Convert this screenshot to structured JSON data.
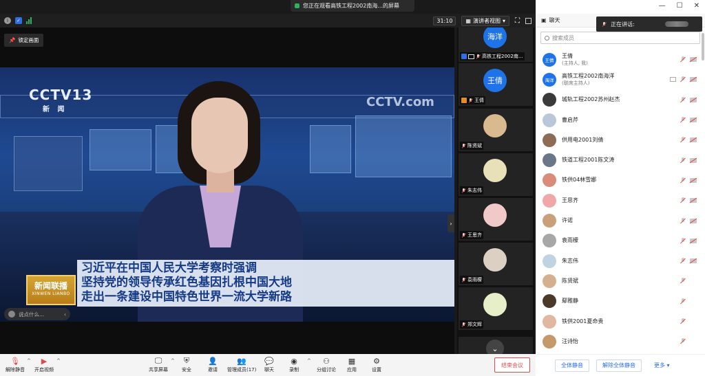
{
  "banner": {
    "text": "您正在观看高铁工程2002南海...的屏幕"
  },
  "topbar": {
    "timer": "31:10",
    "view_label": "演讲者视图"
  },
  "video": {
    "lock_label": "锁定画面",
    "channel_logo": "CCTV13",
    "channel_sub": "新 闻",
    "watermark": "CCTV.com",
    "headline": [
      "习近平在中国人民大学考察时强调",
      "坚持党的领导传承红色基因扎根中国大地",
      "走出一条建设中国特色世界一流大学新路"
    ],
    "program_logo": "新闻联播",
    "program_logo_en": "XINWEN LIANBO",
    "chat_placeholder": "说点什么..."
  },
  "gallery": [
    {
      "avatar_text": "海洋",
      "avatar_color": "#1f73e8",
      "name": "高铁工程2002南...",
      "cohost": true,
      "screen": true
    },
    {
      "avatar_text": "王倩",
      "avatar_color": "#1f73e8",
      "name": "王倩",
      "host": true
    },
    {
      "avatar_text": "",
      "avatar_color": "#d9b98e",
      "name": "陈贤斌"
    },
    {
      "avatar_text": "",
      "avatar_color": "#e7e0b8",
      "name": "朱志伟"
    },
    {
      "avatar_text": "",
      "avatar_color": "#f1c9c9",
      "name": "王思齐"
    },
    {
      "avatar_text": "",
      "avatar_color": "#dcd0c2",
      "name": "袁雨檬"
    },
    {
      "avatar_text": "",
      "avatar_color": "#e6efc8",
      "name": "郑文辉"
    }
  ],
  "toolbar": {
    "unmute": "解除静音",
    "start_video": "开启视频",
    "share": "共享屏幕",
    "security": "安全",
    "invite": "邀请",
    "manage": "管理成员(17)",
    "chat": "聊天",
    "record": "录制",
    "breakout": "分组讨论",
    "apps": "应用",
    "settings": "设置",
    "end": "结束会议"
  },
  "side": {
    "header": "聊天",
    "speaking_label": "正在讲话:",
    "search_placeholder": "搜索成员",
    "participants": [
      {
        "name": "王倩",
        "role": "(主持人, 我)",
        "avatar_text": "王倩",
        "color": "#1f73e8",
        "cam": true
      },
      {
        "name": "高铁工程2002南海洋",
        "role": "(联席主持人)",
        "avatar_text": "海洋",
        "color": "#1f73e8",
        "cam": true,
        "screen": true
      },
      {
        "name": "城轨工程2002苏州赵杰",
        "avatar_text": "",
        "color": "#3a3a3a",
        "cam": true
      },
      {
        "name": "曹启芹",
        "avatar_text": "",
        "color": "#b9c7d9",
        "cam": true
      },
      {
        "name": "供用电2001刘倩",
        "avatar_text": "",
        "color": "#8c6c55",
        "cam": true
      },
      {
        "name": "铁道工程2001陈文涛",
        "avatar_text": "",
        "color": "#6a7788",
        "cam": true
      },
      {
        "name": "铁供04林雪娜",
        "avatar_text": "",
        "color": "#d98c7a",
        "cam": true
      },
      {
        "name": "王思齐",
        "avatar_text": "",
        "color": "#f1a7a7",
        "cam": true
      },
      {
        "name": "许诺",
        "avatar_text": "",
        "color": "#c9a07a",
        "cam": true
      },
      {
        "name": "袁雨檬",
        "avatar_text": "",
        "color": "#a7a7a7",
        "cam": true
      },
      {
        "name": "朱志伟",
        "avatar_text": "",
        "color": "#bfd3e0",
        "cam": true
      },
      {
        "name": "陈贤斌",
        "avatar_text": "",
        "color": "#d4b08e",
        "cam": false
      },
      {
        "name": "鄢雅静",
        "avatar_text": "",
        "color": "#4a3a2a",
        "cam": false
      },
      {
        "name": "铁供2001夏命贵",
        "avatar_text": "",
        "color": "#e0b8a0",
        "cam": false
      },
      {
        "name": "汪诗怡",
        "avatar_text": "",
        "color": "#c49a6c",
        "cam": false
      }
    ],
    "mute_all": "全体静音",
    "unmute_all": "解除全体静音",
    "more": "更多"
  }
}
